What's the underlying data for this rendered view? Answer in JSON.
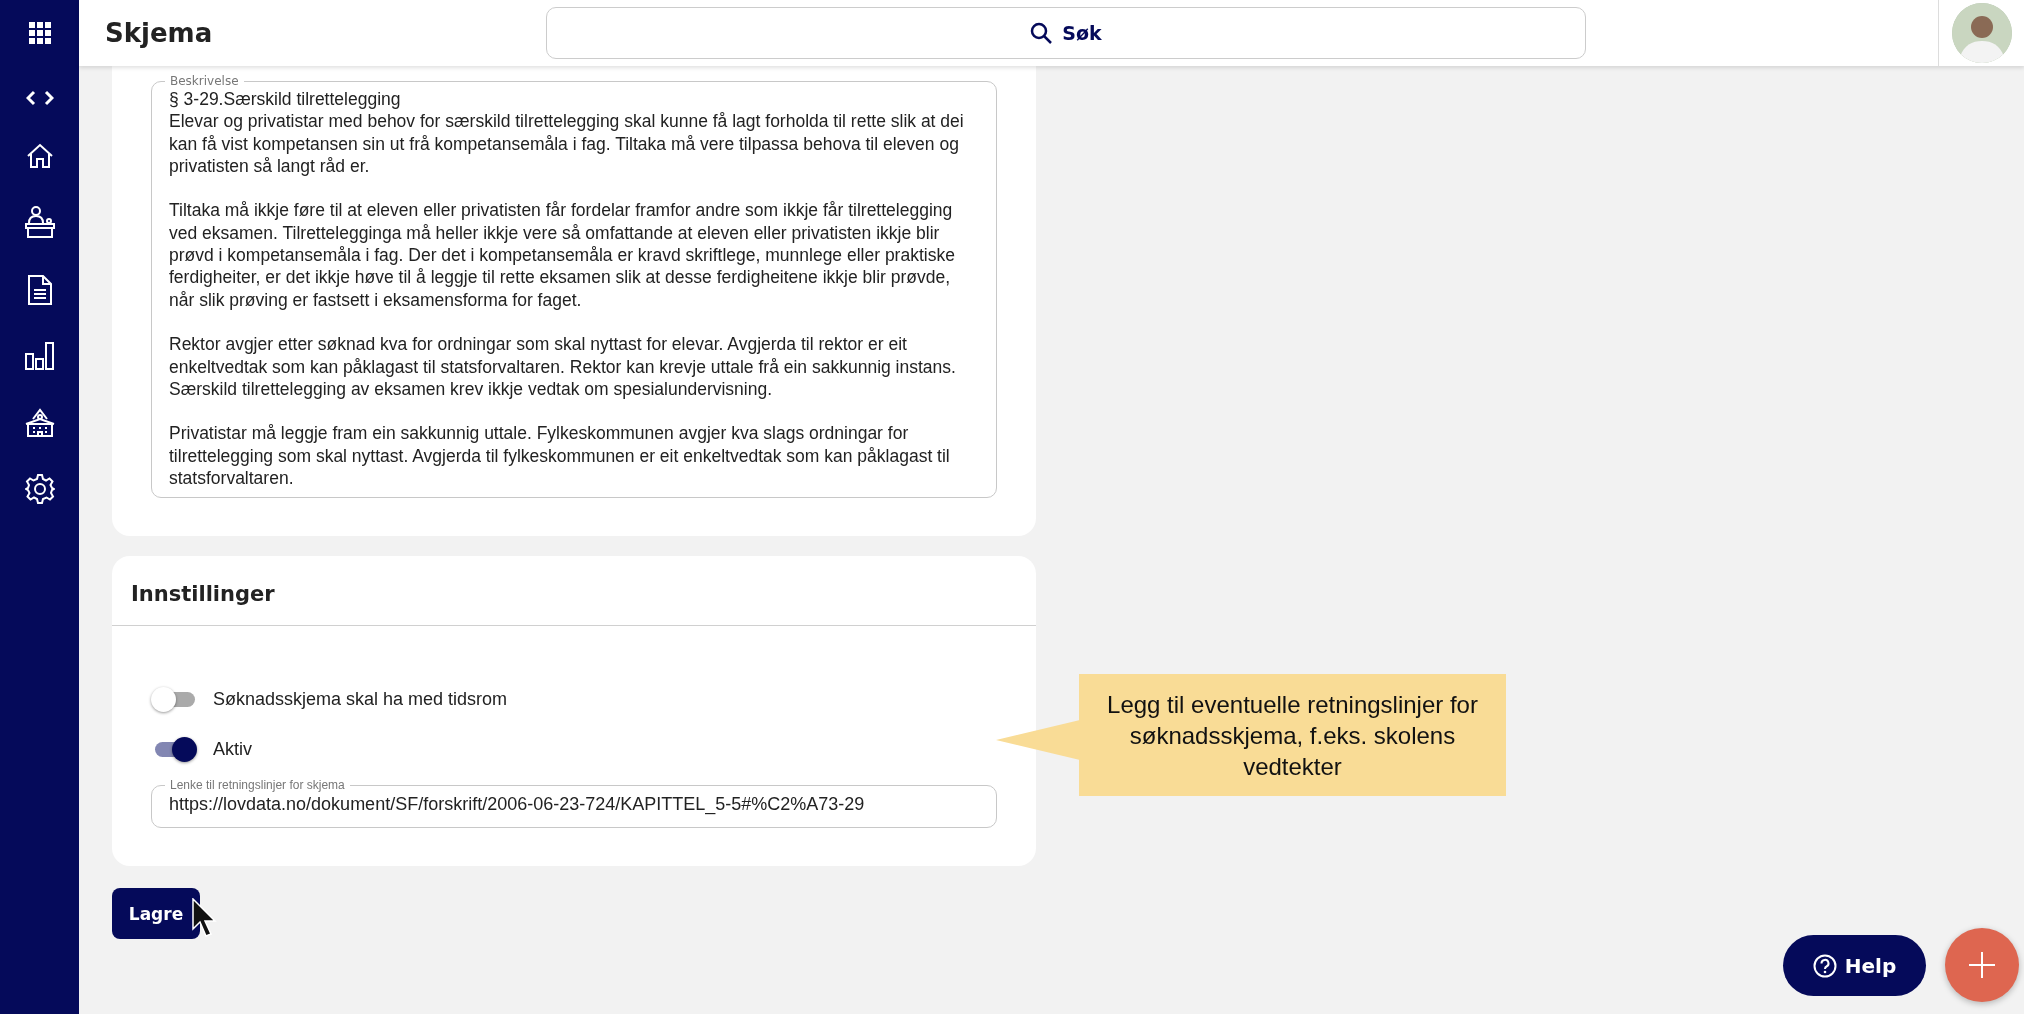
{
  "app_bar": {
    "title": "Skjema",
    "search": {
      "placeholder": "Søk"
    }
  },
  "description": {
    "label": "Beskrivelse",
    "value": "§ 3-29.Særskild tilrettelegging\nElevar og privatistar med behov for særskild tilrettelegging skal kunne få lagt forholda til rette slik at dei kan få vist kompetansen sin ut frå kompetansemåla i fag. Tiltaka må vere tilpassa behova til eleven og privatisten så langt råd er.\n\nTiltaka må ikkje føre til at eleven eller privatisten får fordelar framfor andre som ikkje får tilrettelegging ved eksamen. Tilrettelegginga må heller ikkje vere så omfattande at eleven eller privatisten ikkje blir prøvd i kompetansemåla i fag. Der det i kompetansemåla er kravd skriftlege, munnlege eller praktiske ferdigheiter, er det ikkje høve til å leggje til rette eksamen slik at desse ferdigheitene ikkje blir prøvde, når slik prøving er fastsett i eksamensforma for faget.\n\nRektor avgjer etter søknad kva for ordningar som skal nyttast for elevar. Avgjerda til rektor er eit enkeltvedtak som kan påklagast til statsforvaltaren. Rektor kan krevje uttale frå ein sakkunnig instans. Særskild tilrettelegging av eksamen krev ikkje vedtak om spesialundervisning.\n\nPrivatistar må leggje fram ein sakkunnig uttale. Fylkeskommunen avgjer kva slags ordningar for tilrettelegging som skal nyttast. Avgjerda til fylkeskommunen er eit enkeltvedtak som kan påklagast til statsforvaltaren."
  },
  "settings": {
    "title": "Innstillinger",
    "toggles": [
      {
        "label": "Søknadsskjema skal ha med tidsrom",
        "on": false
      },
      {
        "label": "Aktiv",
        "on": true
      }
    ],
    "link_field": {
      "label": "Lenke til retningslinjer for skjema",
      "value": "https://lovdata.no/dokument/SF/forskrift/2006-06-23-724/KAPITTEL_5-5#%C2%A73-29"
    }
  },
  "save_button": "Lagre",
  "callout": "Legg til eventuelle retningslinjer for søknadsskjema, f.eks. skolens vedtekter",
  "help_button": "Help"
}
